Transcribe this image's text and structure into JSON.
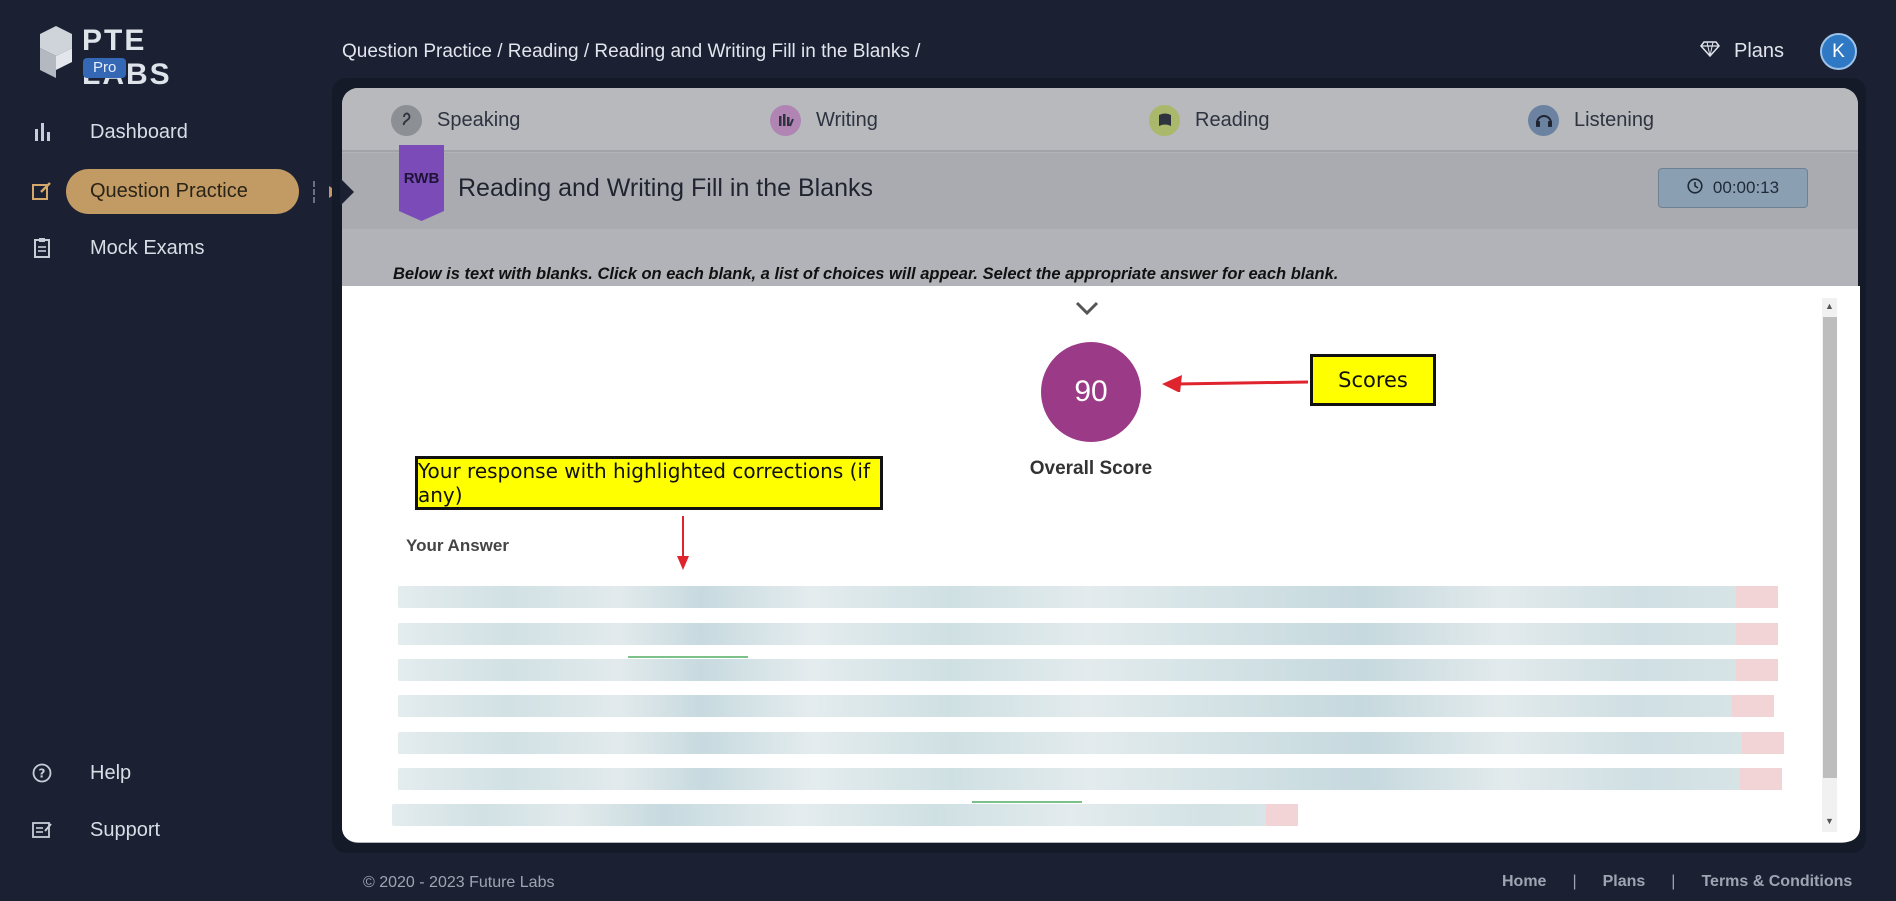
{
  "brand": {
    "name": "PTE LABS",
    "badge": "Pro"
  },
  "sidebar": {
    "items": [
      {
        "label": "Dashboard",
        "icon": "bar-chart-icon"
      },
      {
        "label": "Question Practice",
        "icon": "edit-icon",
        "active": true
      },
      {
        "label": "Mock Exams",
        "icon": "clipboard-icon"
      },
      {
        "label": "Help",
        "icon": "question-circle-icon"
      },
      {
        "label": "Support",
        "icon": "support-icon"
      }
    ]
  },
  "header": {
    "breadcrumb": "Question Practice / Reading / Reading and Writing Fill in the Blanks /",
    "plans_label": "Plans",
    "avatar_initial": "K"
  },
  "tabs": [
    {
      "label": "Speaking",
      "icon": "speaking-icon",
      "color": "#8c8f94"
    },
    {
      "label": "Writing",
      "icon": "writing-icon",
      "color": "#b085b4"
    },
    {
      "label": "Reading",
      "icon": "reading-icon",
      "color": "#a9b86a"
    },
    {
      "label": "Listening",
      "icon": "headphones-icon",
      "color": "#6b83a0"
    }
  ],
  "question": {
    "badge": "RWB",
    "title": "Reading and Writing Fill in the Blanks",
    "timer": "00:00:13",
    "instruction": "Below is text with blanks. Click on each blank, a list of choices will appear. Select the appropriate answer for each blank."
  },
  "result": {
    "score": "90",
    "score_label": "Overall Score",
    "your_answer_label": "Your Answer",
    "callout_scores": "Scores",
    "callout_response": "Your response with highlighted corrections (if any)"
  },
  "colors": {
    "background": "#1b2133",
    "accent_gold": "#c29a64",
    "score_purple": "#9b3a87",
    "callout_yellow": "#ffff00",
    "arrow_red": "#e0242d"
  },
  "footer": {
    "copyright": "© 2020 - 2023 Future Labs",
    "links": [
      "Home",
      "Plans",
      "Terms & Conditions"
    ]
  }
}
